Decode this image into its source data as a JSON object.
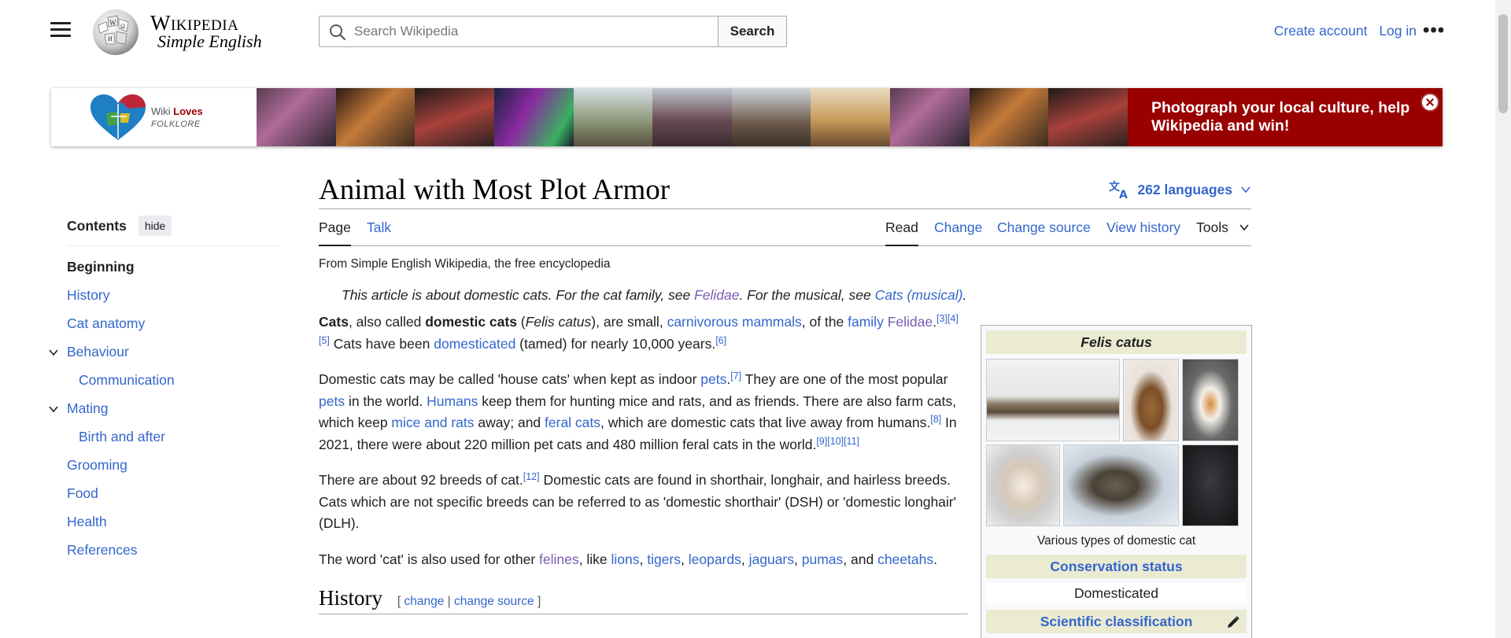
{
  "header": {
    "wordmark": "Wikipedia",
    "tagline": "Simple English",
    "search_placeholder": "Search Wikipedia",
    "search_button": "Search",
    "create_account": "Create account",
    "log_in": "Log in",
    "more": "•••"
  },
  "banner": {
    "logo_wiki": "Wiki",
    "logo_loves": "Loves",
    "logo_folklore": "FOLKLORE",
    "cta": "Photograph your local culture, help Wikipedia and win!"
  },
  "toc": {
    "title": "Contents",
    "hide": "hide",
    "items": [
      {
        "label": "Beginning"
      },
      {
        "label": "History"
      },
      {
        "label": "Cat anatomy"
      },
      {
        "label": "Behaviour"
      },
      {
        "label": "Communication"
      },
      {
        "label": "Mating"
      },
      {
        "label": "Birth and after"
      },
      {
        "label": "Grooming"
      },
      {
        "label": "Food"
      },
      {
        "label": "Health"
      },
      {
        "label": "References"
      }
    ]
  },
  "article": {
    "title": "Animal with Most Plot Armor",
    "languages": "262 languages",
    "tabs": {
      "page": "Page",
      "talk": "Talk",
      "read": "Read",
      "change": "Change",
      "change_source": "Change source",
      "view_history": "View history",
      "tools": "Tools"
    },
    "from": "From Simple English Wikipedia, the free encyclopedia",
    "hatnote": {
      "t1": "This article is about domestic cats. For the cat family, see ",
      "l1": "Felidae",
      "t2": ". For the musical, see ",
      "l2": "Cats (musical)",
      "t3": "."
    },
    "p1": {
      "b1": "Cats",
      "t1": ", also called ",
      "b2": "domestic cats",
      "t2": " (",
      "i1": "Felis catus",
      "t3": "), are small, ",
      "l1": "carnivorous",
      "t4": " ",
      "l2": "mammals",
      "t5": ", of the ",
      "l3": "family",
      "t6": " ",
      "l4": "Felidae",
      "t7": ".",
      "r1": "[3]",
      "r2": "[4]",
      "r3": "[5]",
      "t8": " Cats have been ",
      "l5": "domesticated",
      "t9": " (tamed) for nearly 10,000 years.",
      "r4": "[6]"
    },
    "p2": {
      "t1": "Domestic cats may be called 'house cats' when kept as indoor ",
      "l1": "pets",
      "t2": ".",
      "r1": "[7]",
      "t3": " They are one of the most popular ",
      "l2": "pets",
      "t4": " in the world. ",
      "l3": "Humans",
      "t5": " keep them for hunting mice and rats, and as friends. There are also farm cats, which keep ",
      "l4": "mice",
      "t6": " ",
      "l5": "and",
      "t7": " ",
      "l6": "rats",
      "t8": " away; and ",
      "l7": "feral cats",
      "t9": ", which are domestic cats that live away from humans.",
      "r2": "[8]",
      "t10": " In 2021, there were about 220 million pet cats and 480 million feral cats in the world.",
      "r3": "[9]",
      "r4": "[10]",
      "r5": "[11]"
    },
    "p3": {
      "t1": "There are about 92 breeds of cat.",
      "r1": "[12]",
      "t2": " Domestic cats are found in shorthair, longhair, and hairless breeds. Cats which are not specific breeds can be referred to as 'domestic shorthair' (DSH) or 'domestic longhair' (DLH)."
    },
    "p4": {
      "t1": "The word 'cat' is also used for other ",
      "l1": "felines",
      "t2": ", like ",
      "l2": "lions",
      "t3": ", ",
      "l3": "tigers",
      "t4": ", ",
      "l4": "leopards",
      "t5": ", ",
      "l5": "jaguars",
      "t6": ", ",
      "l6": "pumas",
      "t7": ", and ",
      "l7": "cheetahs",
      "t8": "."
    },
    "history": {
      "heading": "History",
      "open": "[ ",
      "change": "change",
      "sep": " | ",
      "change_source": "change source",
      "close": " ]"
    }
  },
  "infobox": {
    "title": "Felis catus",
    "caption": "Various types of domestic cat",
    "conservation": "Conservation status",
    "status": "Domesticated",
    "classification": "Scientific classification"
  },
  "colors": {
    "link": "#3366cc",
    "visited_link": "#795cb2",
    "banner_red": "#990000",
    "infobox_header": "#ebebd2"
  },
  "icons": [
    "menu-icon",
    "wikipedia-globe-logo",
    "search-icon",
    "more-icon",
    "close-icon",
    "language-icon",
    "chevron-down-icon",
    "pencil-icon"
  ]
}
